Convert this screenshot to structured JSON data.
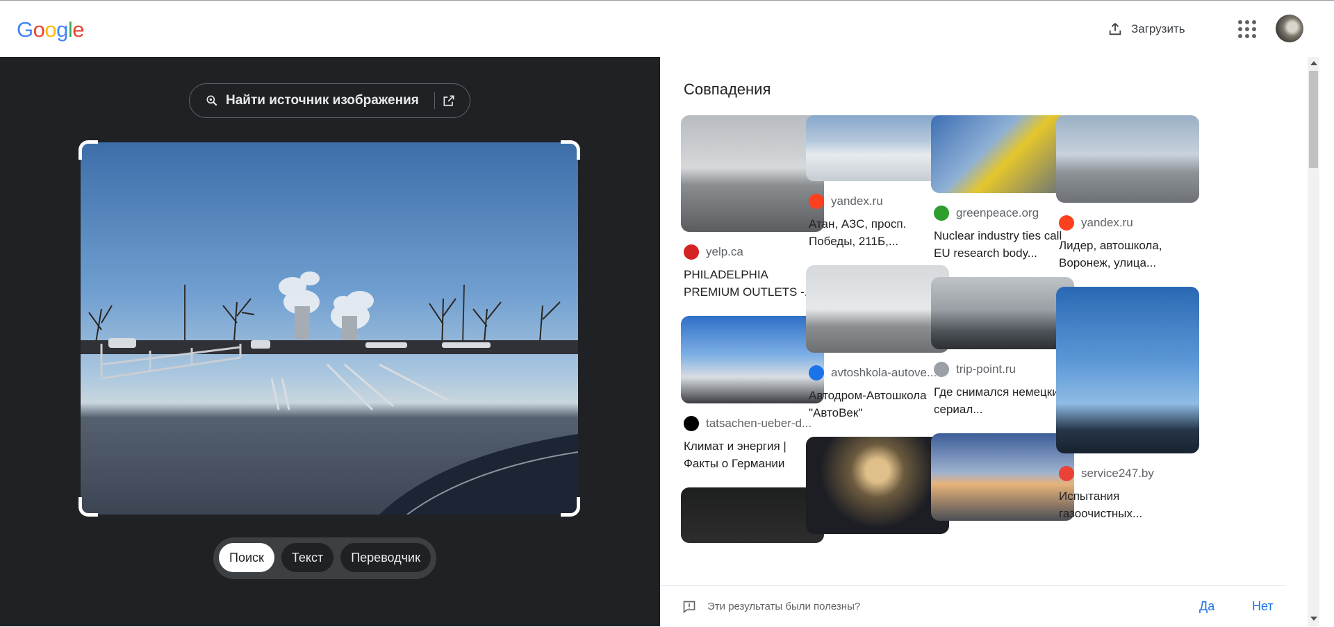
{
  "header": {
    "logo_letters": [
      {
        "ch": "G",
        "color": "#4285f4"
      },
      {
        "ch": "o",
        "color": "#ea4335"
      },
      {
        "ch": "o",
        "color": "#fbbc05"
      },
      {
        "ch": "g",
        "color": "#4285f4"
      },
      {
        "ch": "l",
        "color": "#34a853"
      },
      {
        "ch": "e",
        "color": "#ea4335"
      }
    ],
    "upload_label": "Загрузить",
    "upload_icon": "upload-icon",
    "apps_icon": "apps-grid-icon"
  },
  "left_panel": {
    "find_source_label": "Найти источник изображения",
    "find_source_icon": "lens-search-icon",
    "open_external_icon": "open-external-icon",
    "modes": [
      {
        "label": "Поиск",
        "active": true
      },
      {
        "label": "Текст",
        "active": false
      },
      {
        "label": "Переводчик",
        "active": false
      }
    ]
  },
  "results": {
    "title": "Совпадения",
    "columns": [
      [
        {
          "source": "yelp.ca",
          "favicon": "yelp-icon",
          "favicon_color": "#d32323",
          "caption": "PHILADELPHIA PREMIUM OUTLETS -...",
          "thumb": "outlets"
        },
        {
          "source": "tatsachen-ueber-d...",
          "favicon": "germany-flag-icon",
          "favicon_color": "#000000",
          "caption": "Климат и энергия | Факты о Германии",
          "thumb": "stop"
        },
        {
          "source": "",
          "favicon": "",
          "favicon_color": "#000000",
          "caption": "",
          "thumb": "dark"
        }
      ],
      [
        {
          "source": "yandex.ru",
          "favicon": "yandex-icon",
          "favicon_color": "#fc3f1d",
          "caption": "Атан, АЗС, просп. Победы, 211Б,...",
          "thumb": "snow"
        },
        {
          "source": "avtoshkola-autove...",
          "favicon": "car-icon",
          "favicon_color": "#1a73e8",
          "caption": "Автодром-Автошкола \"АвтоВек\"",
          "thumb": "pylons"
        },
        {
          "source": "",
          "favicon": "",
          "favicon_color": "#000000",
          "caption": "",
          "thumb": "night"
        }
      ],
      [
        {
          "source": "greenpeace.org",
          "favicon": "greenpeace-icon",
          "favicon_color": "#2e9e2e",
          "caption": "Nuclear industry ties call EU research body...",
          "thumb": "tape"
        },
        {
          "source": "trip-point.ru",
          "favicon": "trip-point-icon",
          "favicon_color": "#9aa0a6",
          "caption": "Где снимался немецкий сериал...",
          "thumb": "cars"
        },
        {
          "source": "",
          "favicon": "",
          "favicon_color": "#000000",
          "caption": "",
          "thumb": "dusk"
        }
      ],
      [
        {
          "source": "yandex.ru",
          "favicon": "yandex-icon",
          "favicon_color": "#fc3f1d",
          "caption": "Лидер, автошкола, Воронеж, улица...",
          "thumb": "lot"
        },
        {
          "source": "service247.by",
          "favicon": "service247-icon",
          "favicon_color": "#ea4335",
          "caption": "Испытания газоочистных...",
          "thumb": "plume"
        }
      ]
    ]
  },
  "feedback": {
    "question": "Эти результаты были полезны?",
    "yes": "Да",
    "no": "Нет"
  }
}
